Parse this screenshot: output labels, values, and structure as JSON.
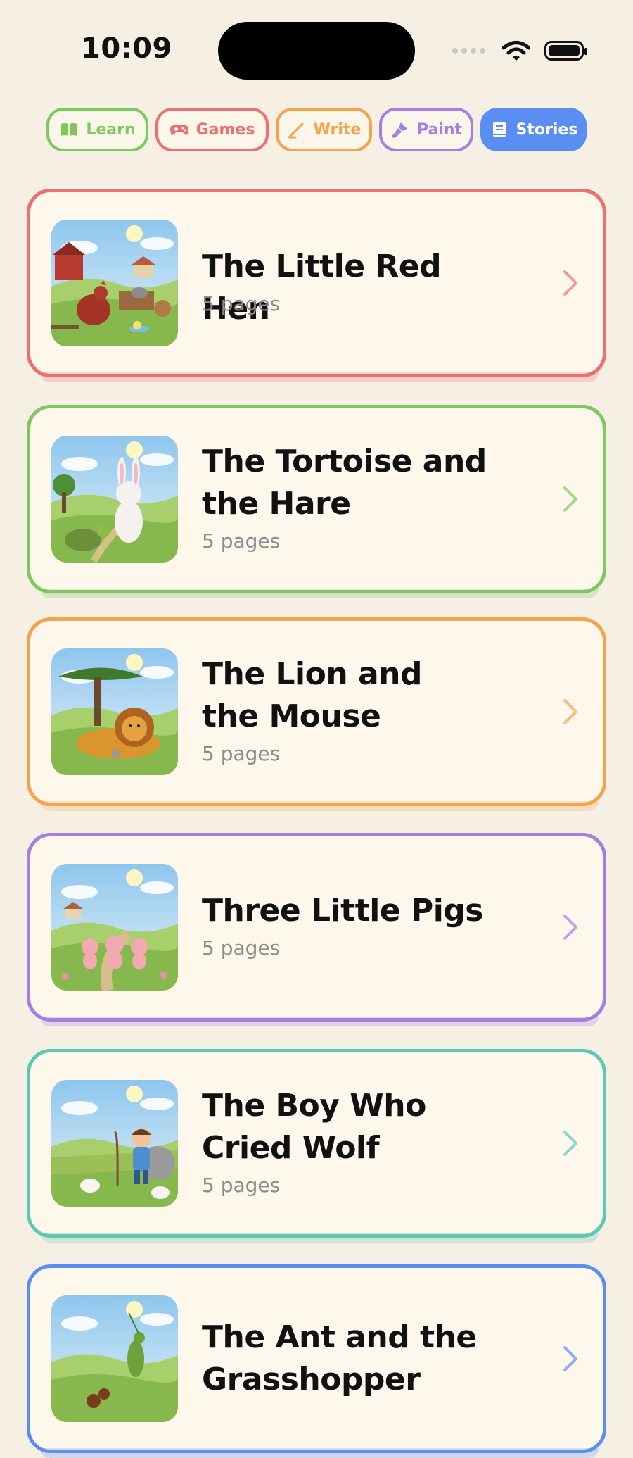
{
  "status_bar": {
    "time": "10:09"
  },
  "tabs": [
    {
      "label": "Learn",
      "color": "#7dc95e",
      "icon": "book-icon"
    },
    {
      "label": "Games",
      "color": "#ef6f6f",
      "icon": "gamepad-icon"
    },
    {
      "label": "Write",
      "color": "#f6a24b",
      "icon": "pencil-icon"
    },
    {
      "label": "Paint",
      "color": "#a47ee0",
      "icon": "paintbrush-icon"
    },
    {
      "label": "Stories",
      "color": "#5b8ef2",
      "icon": "storybook-icon",
      "active": true
    }
  ],
  "stories": [
    {
      "title_lines": [
        "The Little Red Hen"
      ],
      "pages": "5 pages",
      "color": "#ef6f6f",
      "image": "little-red-hen-illustration"
    },
    {
      "title_lines": [
        "The Tortoise and",
        "the Hare"
      ],
      "pages": "5 pages",
      "color": "#7dc95e",
      "image": "tortoise-and-hare-illustration"
    },
    {
      "title_lines": [
        "The Lion and",
        "the Mouse"
      ],
      "pages": "5 pages",
      "color": "#f6a24b",
      "image": "lion-and-mouse-illustration"
    },
    {
      "title_lines": [
        "Three Little Pigs"
      ],
      "pages": "5 pages",
      "color": "#a47ee0",
      "image": "three-little-pigs-illustration"
    },
    {
      "title_lines": [
        "The Boy Who",
        "Cried Wolf"
      ],
      "pages": "5 pages",
      "color": "#5cc9b5",
      "image": "boy-who-cried-wolf-illustration"
    },
    {
      "title_lines": [
        "The Ant and the",
        "Grasshopper"
      ],
      "pages": "",
      "color": "#5b8ef2",
      "image": "ant-and-grasshopper-illustration"
    }
  ]
}
